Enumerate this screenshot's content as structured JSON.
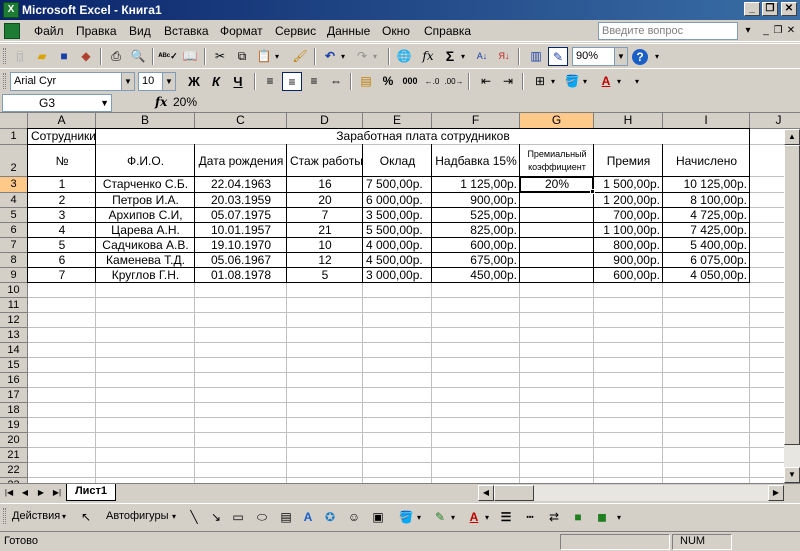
{
  "window": {
    "title": "Microsoft Excel - Книга1",
    "minimize": "_",
    "restore": "❐",
    "close": "✕"
  },
  "menu": {
    "items": [
      "Файл",
      "Правка",
      "Вид",
      "Вставка",
      "Формат",
      "Сервис",
      "Данные",
      "Окно",
      "Справка"
    ],
    "help_placeholder": "Введите вопрос"
  },
  "standard_toolbar": {
    "zoom": "90%",
    "icons": [
      "new-icon",
      "open-icon",
      "save-icon",
      "permission-icon",
      "print-icon",
      "print-preview-icon",
      "spelling-icon",
      "research-icon",
      "cut-icon",
      "copy-icon",
      "paste-icon",
      "format-painter-icon",
      "undo-icon",
      "redo-icon",
      "hyperlink-icon",
      "function-icon",
      "autosum-icon",
      "sort-asc-icon",
      "sort-desc-icon",
      "chart-icon",
      "drawing-icon",
      "help-icon"
    ]
  },
  "format_toolbar": {
    "font": "Arial Cyr",
    "font_size": "10",
    "bold": "Ж",
    "italic": "К",
    "underline": "Ч"
  },
  "formula_bar": {
    "name_box": "G3",
    "fx": "fx",
    "value": "20%"
  },
  "columns": [
    "A",
    "B",
    "C",
    "D",
    "E",
    "F",
    "G",
    "H",
    "I",
    "J"
  ],
  "rows": [
    "1",
    "2",
    "3",
    "4",
    "5",
    "6",
    "7",
    "8",
    "9",
    "10",
    "11",
    "12",
    "13",
    "14",
    "15",
    "16",
    "17",
    "18",
    "19",
    "20",
    "21",
    "22",
    "23"
  ],
  "sheet": {
    "a1": "Сотрудники",
    "title": "Заработная плата сотрудников",
    "headers": [
      "№",
      "Ф.И.О.",
      "Дата рождения",
      "Стаж работы",
      "Оклад",
      "Надбавка 15%",
      "Премиальный коэффициент",
      "Премия",
      "Начислено"
    ],
    "data": [
      [
        "1",
        "Старченко С.Б.",
        "22.04.1963",
        "16",
        "7 500,00р.",
        "1 125,00р.",
        "20%",
        "1 500,00р.",
        "10 125,00р."
      ],
      [
        "2",
        "Петров И.А.",
        "20.03.1959",
        "20",
        "6 000,00р.",
        "900,00р.",
        "",
        "1 200,00р.",
        "8 100,00р."
      ],
      [
        "3",
        "Архипов С.И,",
        "05.07.1975",
        "7",
        "3 500,00р.",
        "525,00р.",
        "",
        "700,00р.",
        "4 725,00р."
      ],
      [
        "4",
        "Царева А.Н.",
        "10.01.1957",
        "21",
        "5 500,00р.",
        "825,00р.",
        "",
        "1 100,00р.",
        "7 425,00р."
      ],
      [
        "5",
        "Садчикова А.В.",
        "19.10.1970",
        "10",
        "4 000,00р.",
        "600,00р.",
        "",
        "800,00р.",
        "5 400,00р."
      ],
      [
        "6",
        "Каменева Т.Д.",
        "05.06.1967",
        "12",
        "4 500,00р.",
        "675,00р.",
        "",
        "900,00р.",
        "6 075,00р."
      ],
      [
        "7",
        "Круглов Г.Н.",
        "01.08.1978",
        "5",
        "3 000,00р.",
        "450,00р.",
        "",
        "600,00р.",
        "4 050,00р."
      ]
    ]
  },
  "sheet_tabs": [
    "Лист1"
  ],
  "drawing_toolbar": {
    "actions": "Действия",
    "autoshapes": "Автофигуры"
  },
  "status": {
    "text": "Готово",
    "num": "NUM"
  }
}
